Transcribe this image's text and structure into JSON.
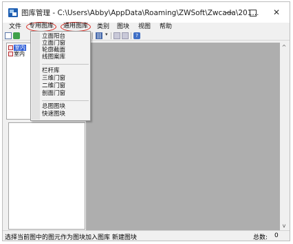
{
  "window": {
    "title": "图库管理 - C:\\Users\\Abby\\AppData\\Roaming\\ZWSoft\\Zwcada\\201...",
    "minimize_glyph": "—",
    "close_glyph": "✕"
  },
  "menubar": {
    "items": [
      "文件",
      "专用图库",
      "通用图库",
      "类别",
      "图块",
      "视图",
      "帮助"
    ]
  },
  "dropdown": {
    "group1": [
      "立面阳台",
      "立面门窗",
      "轮廓截面",
      "线图案库"
    ],
    "group2": [
      "栏杆库",
      "三维门窗",
      "二维门窗",
      "剖面门窗"
    ],
    "group3": [
      "总图图块",
      "快速图块"
    ]
  },
  "tree": {
    "items": [
      "室内",
      "室内"
    ]
  },
  "scrollbar": {
    "up_glyph": "^",
    "down_glyph": "v"
  },
  "toolbar": {
    "help_glyph": "?",
    "arrow_glyph": "▾"
  },
  "statusbar": {
    "message": "选择当前图中的图元作为图块加入图库  新建图块",
    "count_label": "总数:",
    "count_value": "0"
  },
  "colors": {
    "highlight_circle": "#d9261c",
    "selection": "#2a5bd7",
    "workspace": "#aeaeae",
    "app_icon": "#1f5fb2"
  }
}
